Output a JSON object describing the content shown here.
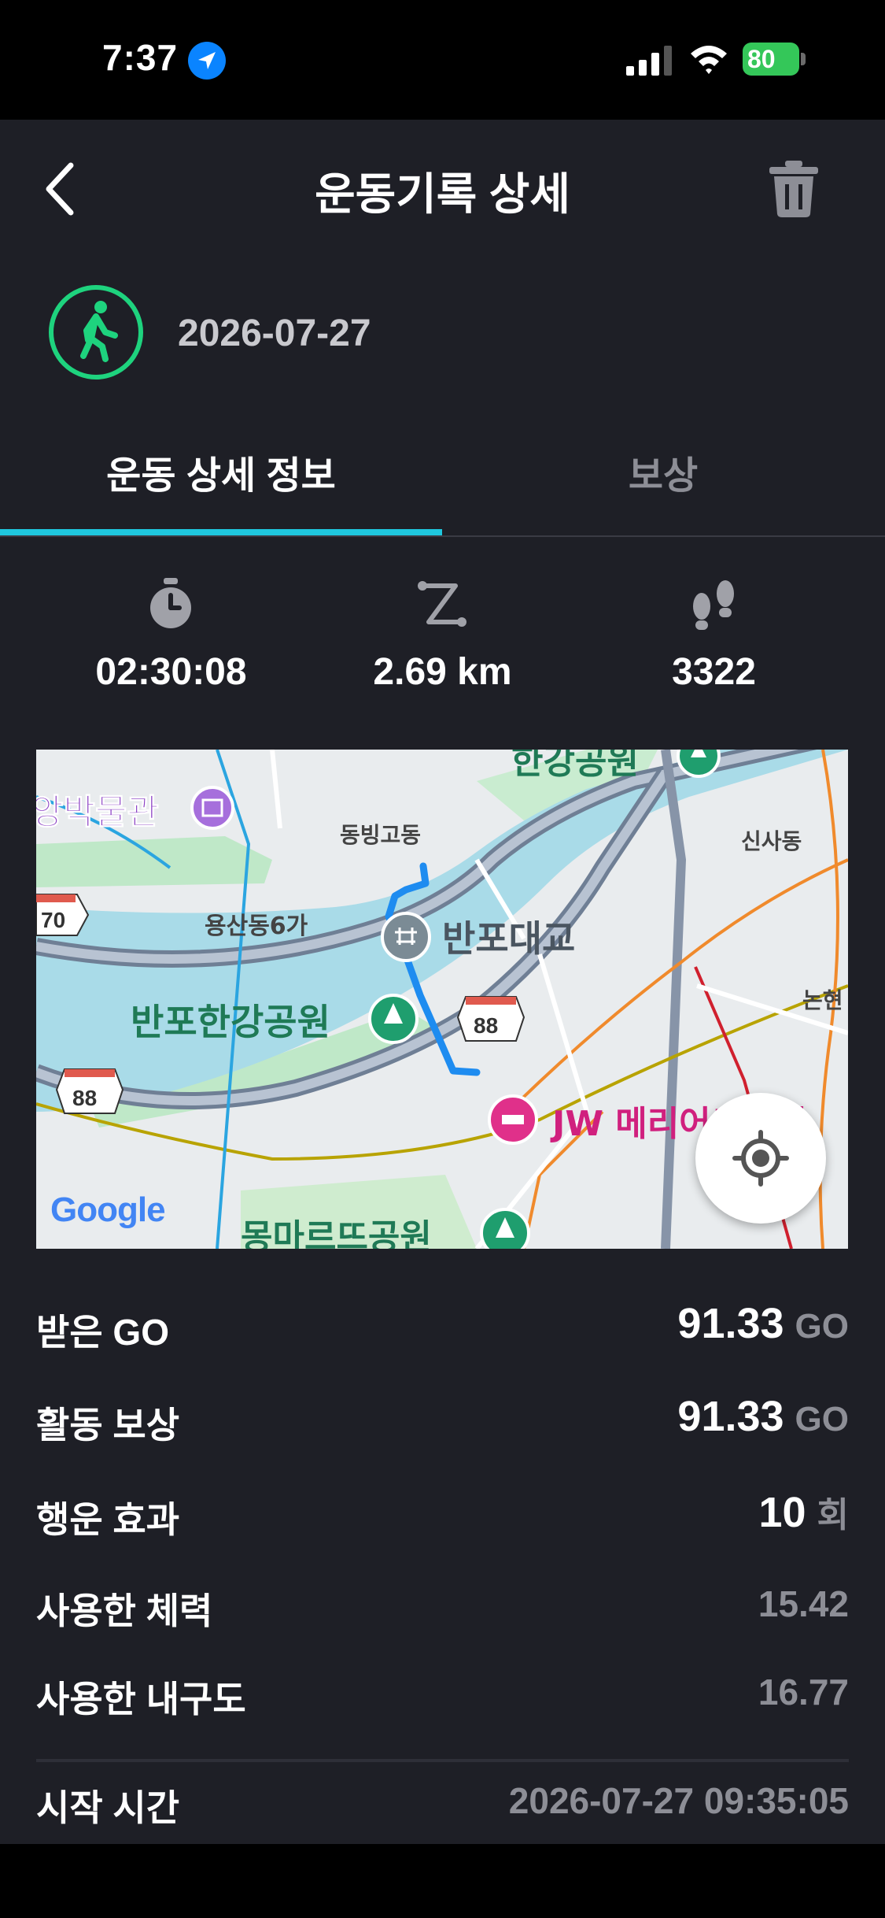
{
  "status_bar": {
    "time": "7:37",
    "battery": "80"
  },
  "header": {
    "title": "운동기록 상세"
  },
  "activity": {
    "date": "2026-07-27"
  },
  "tabs": [
    {
      "label": "운동 상세 정보",
      "active": true
    },
    {
      "label": "보상",
      "active": false
    }
  ],
  "stats": {
    "duration": "02:30:08",
    "distance": "2.69 km",
    "steps": "3322"
  },
  "map": {
    "labels": {
      "museum": "앙박물관",
      "park_top": "한강공원",
      "dongbinggo": "동빙고동",
      "sinsa": "신사동",
      "yongsan6": "용산동6가",
      "banpo_bridge": "반포대교",
      "banpo_park": "반포한강공원",
      "nonhyeon": "논현",
      "jw_marriott": "JW 메리어트호텔",
      "montmartre": "몽마르뜨공원",
      "road_70": "70",
      "road_88a": "88",
      "road_88b": "88",
      "google": "Google"
    }
  },
  "details": [
    {
      "label": "받은 GO",
      "value": "91.33",
      "unit": "GO"
    },
    {
      "label": "활동 보상",
      "value": "91.33",
      "unit": "GO"
    },
    {
      "label": "행운 효과",
      "value": "10",
      "unit": "회"
    },
    {
      "label": "사용한 체력",
      "value": "15.42"
    },
    {
      "label": "사용한 내구도",
      "value": "16.77"
    },
    {
      "label": "시작 시간",
      "value": "2026-07-27 09:35:05"
    }
  ],
  "colors": {
    "accent": "#1fc7de",
    "walk_green": "#1ed37e",
    "background": "#1e1f26"
  }
}
